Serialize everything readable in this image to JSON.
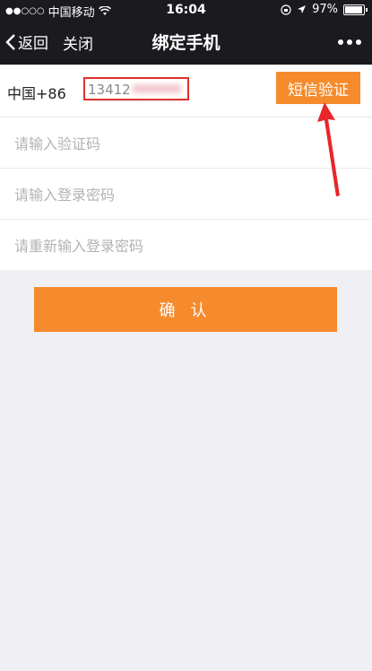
{
  "status_bar": {
    "carrier": "中国移动",
    "time": "16:04",
    "battery": "97%",
    "battery_level": 0.97
  },
  "nav": {
    "back_label": "返回",
    "close_label": "关闭",
    "title": "绑定手机"
  },
  "form": {
    "country_code": "中国+86",
    "phone_value": "13412",
    "sms_button": "短信验证",
    "code_placeholder": "请输入验证码",
    "password_placeholder": "请输入登录密码",
    "confirm_password_placeholder": "请重新输入登录密码",
    "confirm_button": "确 认"
  },
  "colors": {
    "accent": "#f58b2d",
    "nav_bg": "#1b1b1f",
    "highlight": "#e0302d"
  }
}
